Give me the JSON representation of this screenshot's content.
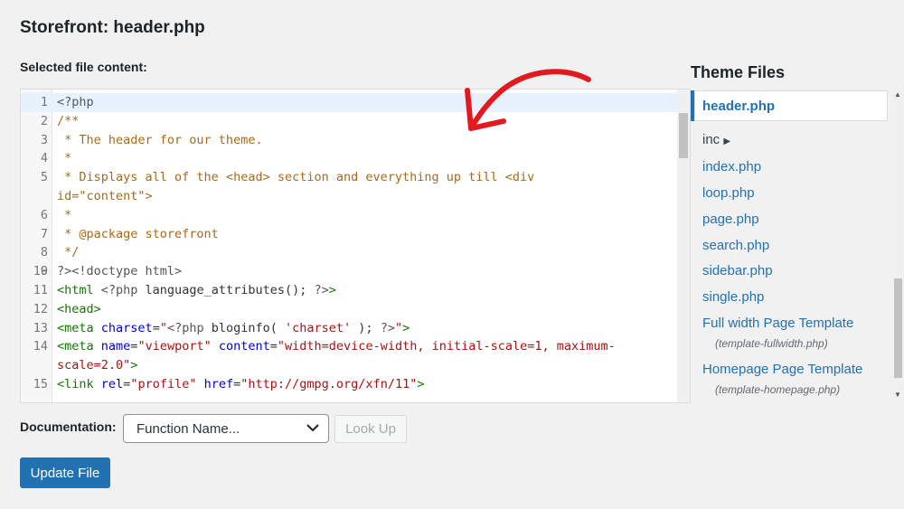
{
  "page_title": "Storefront: header.php",
  "selected_label": "Selected file content:",
  "code_lines": [
    {
      "num": "1",
      "active": true,
      "parts": [
        {
          "c": "meta",
          "t": "<?php"
        }
      ]
    },
    {
      "num": "2",
      "parts": [
        {
          "c": "comment",
          "t": "/**"
        }
      ]
    },
    {
      "num": "3",
      "parts": [
        {
          "c": "comment",
          "t": " * The header for our theme."
        }
      ]
    },
    {
      "num": "4",
      "parts": [
        {
          "c": "comment",
          "t": " *"
        }
      ]
    },
    {
      "num": "5",
      "parts": [
        {
          "c": "comment",
          "t": " * Displays all of the <head> section and everything up till <div"
        }
      ]
    },
    {
      "num": "",
      "parts": [
        {
          "c": "comment",
          "t": "id=\"content\">"
        }
      ]
    },
    {
      "num": "6",
      "parts": [
        {
          "c": "comment",
          "t": " *"
        }
      ]
    },
    {
      "num": "7",
      "parts": [
        {
          "c": "comment",
          "t": " * @package storefront"
        }
      ]
    },
    {
      "num": "8",
      "parts": [
        {
          "c": "comment",
          "t": " */"
        }
      ]
    },
    {
      "num": "9",
      "parts": [
        {
          "c": "plain",
          "t": ""
        }
      ]
    },
    {
      "num": "10",
      "parts": [
        {
          "c": "meta",
          "t": "?>"
        },
        {
          "c": "meta",
          "t": "<!doctype html>"
        }
      ]
    },
    {
      "num": "11",
      "parts": [
        {
          "c": "tag",
          "t": "<html "
        },
        {
          "c": "meta",
          "t": "<?php"
        },
        {
          "c": "plain",
          "t": " language_attributes(); "
        },
        {
          "c": "meta",
          "t": "?>"
        },
        {
          "c": "tag",
          "t": ">"
        }
      ]
    },
    {
      "num": "12",
      "parts": [
        {
          "c": "tag",
          "t": "<head>"
        }
      ]
    },
    {
      "num": "13",
      "parts": [
        {
          "c": "tag",
          "t": "<meta "
        },
        {
          "c": "attr",
          "t": "charset"
        },
        {
          "c": "plain",
          "t": "="
        },
        {
          "c": "str",
          "t": "\""
        },
        {
          "c": "meta",
          "t": "<?php"
        },
        {
          "c": "plain",
          "t": " bloginfo( "
        },
        {
          "c": "str",
          "t": "'charset'"
        },
        {
          "c": "plain",
          "t": " ); "
        },
        {
          "c": "meta",
          "t": "?>"
        },
        {
          "c": "str",
          "t": "\""
        },
        {
          "c": "tag",
          "t": ">"
        }
      ]
    },
    {
      "num": "14",
      "parts": [
        {
          "c": "tag",
          "t": "<meta "
        },
        {
          "c": "attr",
          "t": "name"
        },
        {
          "c": "plain",
          "t": "="
        },
        {
          "c": "str",
          "t": "\"viewport\""
        },
        {
          "c": "plain",
          "t": " "
        },
        {
          "c": "attr",
          "t": "content"
        },
        {
          "c": "plain",
          "t": "="
        },
        {
          "c": "str",
          "t": "\"width=device-width, initial-scale=1, maximum-"
        }
      ]
    },
    {
      "num": "",
      "parts": [
        {
          "c": "str",
          "t": "scale=2.0\""
        },
        {
          "c": "tag",
          "t": ">"
        }
      ]
    },
    {
      "num": "15",
      "parts": [
        {
          "c": "tag",
          "t": "<link "
        },
        {
          "c": "attr",
          "t": "rel"
        },
        {
          "c": "plain",
          "t": "="
        },
        {
          "c": "str",
          "t": "\"profile\""
        },
        {
          "c": "plain",
          "t": " "
        },
        {
          "c": "attr",
          "t": "href"
        },
        {
          "c": "plain",
          "t": "="
        },
        {
          "c": "str",
          "t": "\"http://gmpg.org/xfn/11\""
        },
        {
          "c": "tag",
          "t": ">"
        }
      ]
    }
  ],
  "theme_files": {
    "title": "Theme Files",
    "active": "header.php",
    "folder": "inc",
    "folder_arrow": "▶",
    "items": [
      "index.php",
      "loop.php",
      "page.php",
      "search.php",
      "sidebar.php",
      "single.php"
    ],
    "templates": [
      {
        "name": "Full width Page Template",
        "file": "(template-fullwidth.php)"
      },
      {
        "name": "Homepage Page Template",
        "file": "(template-homepage.php)"
      }
    ]
  },
  "documentation": {
    "label": "Documentation:",
    "select_value": "Function Name...",
    "lookup_label": "Look Up"
  },
  "update_label": "Update File",
  "icons": {
    "arrow": "red-arrow-annotation",
    "chevron": "chevron-down-icon",
    "scroll_up": "▲",
    "scroll_down": "▼"
  },
  "colors": {
    "accent": "#2271b1",
    "arrow": "#e4181f"
  }
}
